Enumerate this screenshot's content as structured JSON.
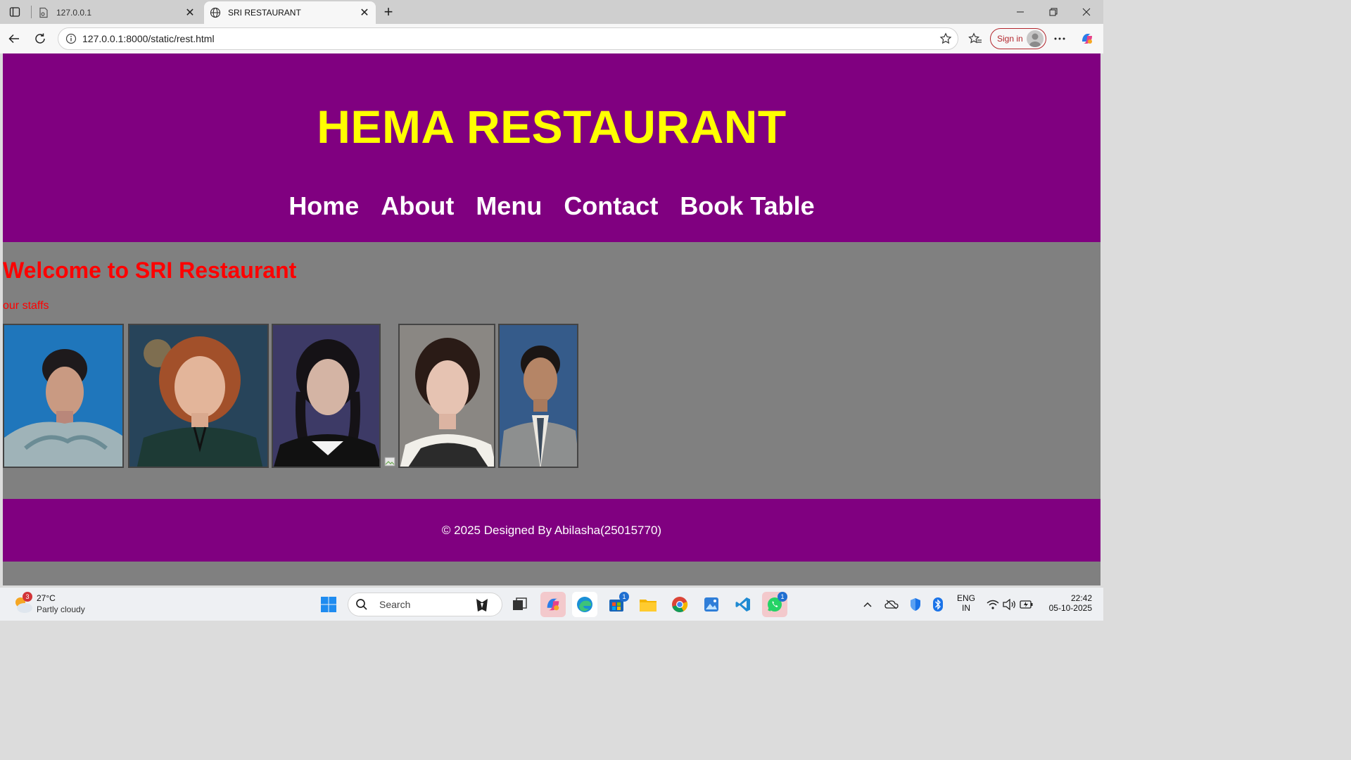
{
  "browser": {
    "tabs": [
      {
        "title": "127.0.0.1",
        "active": false
      },
      {
        "title": "SRI RESTAURANT",
        "active": true
      }
    ],
    "url": "127.0.0.1:8000/static/rest.html",
    "signin_label": "Sign in"
  },
  "site": {
    "title": "HEMA RESTAURANT",
    "nav": [
      "Home",
      "About",
      "Menu",
      "Contact",
      "Book Table"
    ],
    "welcome": "Welcome to SRI Restaurant",
    "staff_label": "our staffs",
    "footer": "© 2025 Designed By Abilasha(25015770)"
  },
  "colors": {
    "header_bg": "#800080",
    "title": "#ffff00",
    "body_bg": "#808080",
    "accent_text": "#ff0000"
  },
  "taskbar": {
    "weather_badge": "3",
    "temperature": "27°C",
    "condition": "Partly cloudy",
    "search_placeholder": "Search",
    "store_badge": "1",
    "whatsapp_badge": "1",
    "lang_line1": "ENG",
    "lang_line2": "IN",
    "time": "22:42",
    "date": "05-10-2025"
  }
}
